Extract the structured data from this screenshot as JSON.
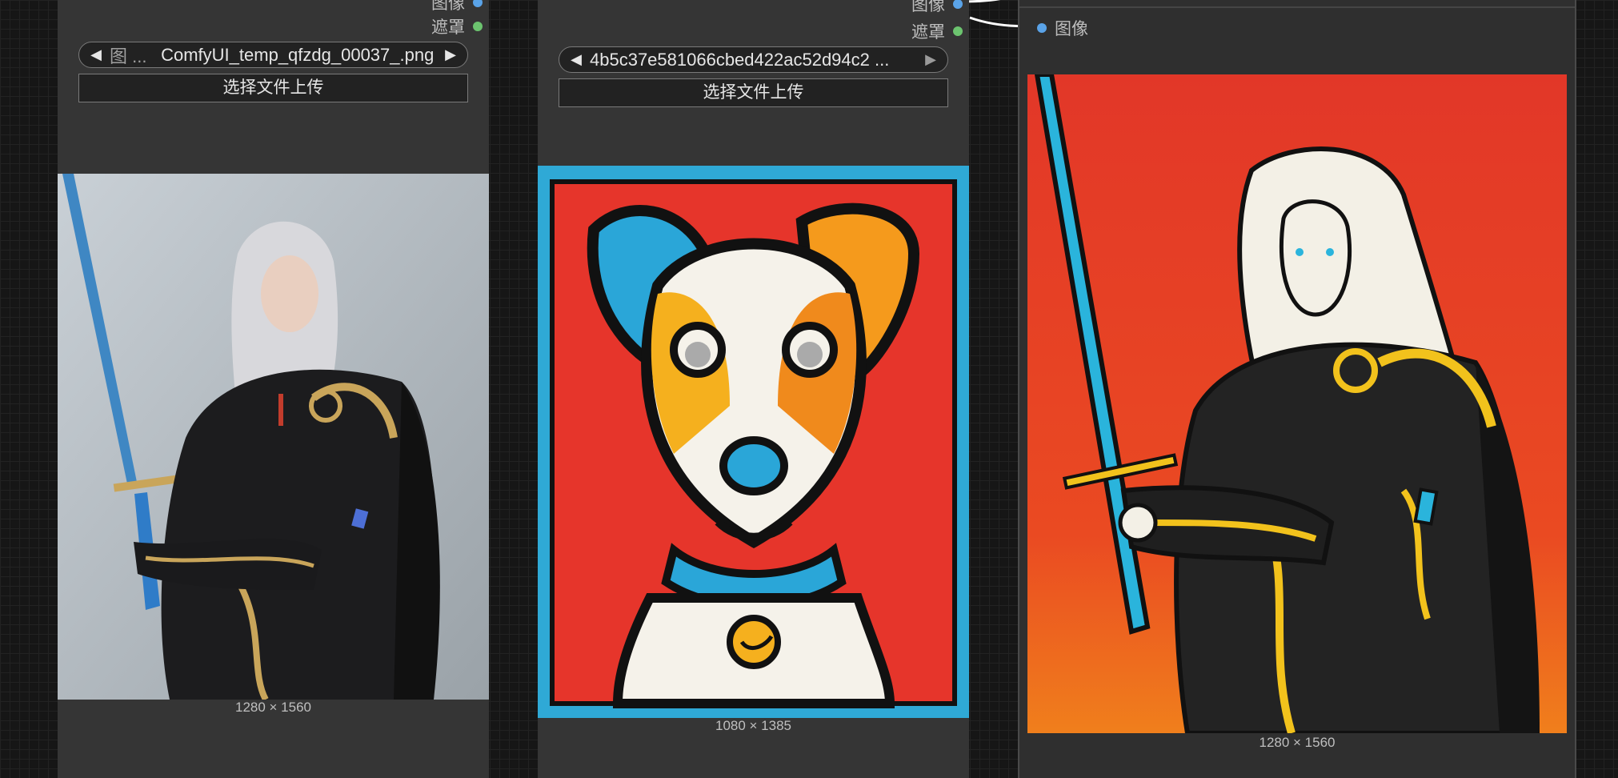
{
  "node1": {
    "output_image": "图像",
    "output_mask": "遮罩",
    "combo_label": "图 ...",
    "combo_value": "ComfyUI_temp_qfzdg_00037_.png",
    "upload_label": "选择文件上传",
    "image_size": "1280 × 1560"
  },
  "node2": {
    "output_image": "图像",
    "output_mask": "遮罩",
    "combo_value": "4b5c37e581066cbed422ac52d94c2 ...",
    "upload_label": "选择文件上传",
    "image_size": "1080 × 1385"
  },
  "node3": {
    "input_image": "图像",
    "image_size": "1280 × 1560"
  },
  "icons": {
    "left_arrow": "◀",
    "right_arrow": "▶"
  },
  "colors": {
    "node_bg": "#353535",
    "image_socket": "#5aa3e8",
    "mask_socket": "#6cc46f"
  }
}
